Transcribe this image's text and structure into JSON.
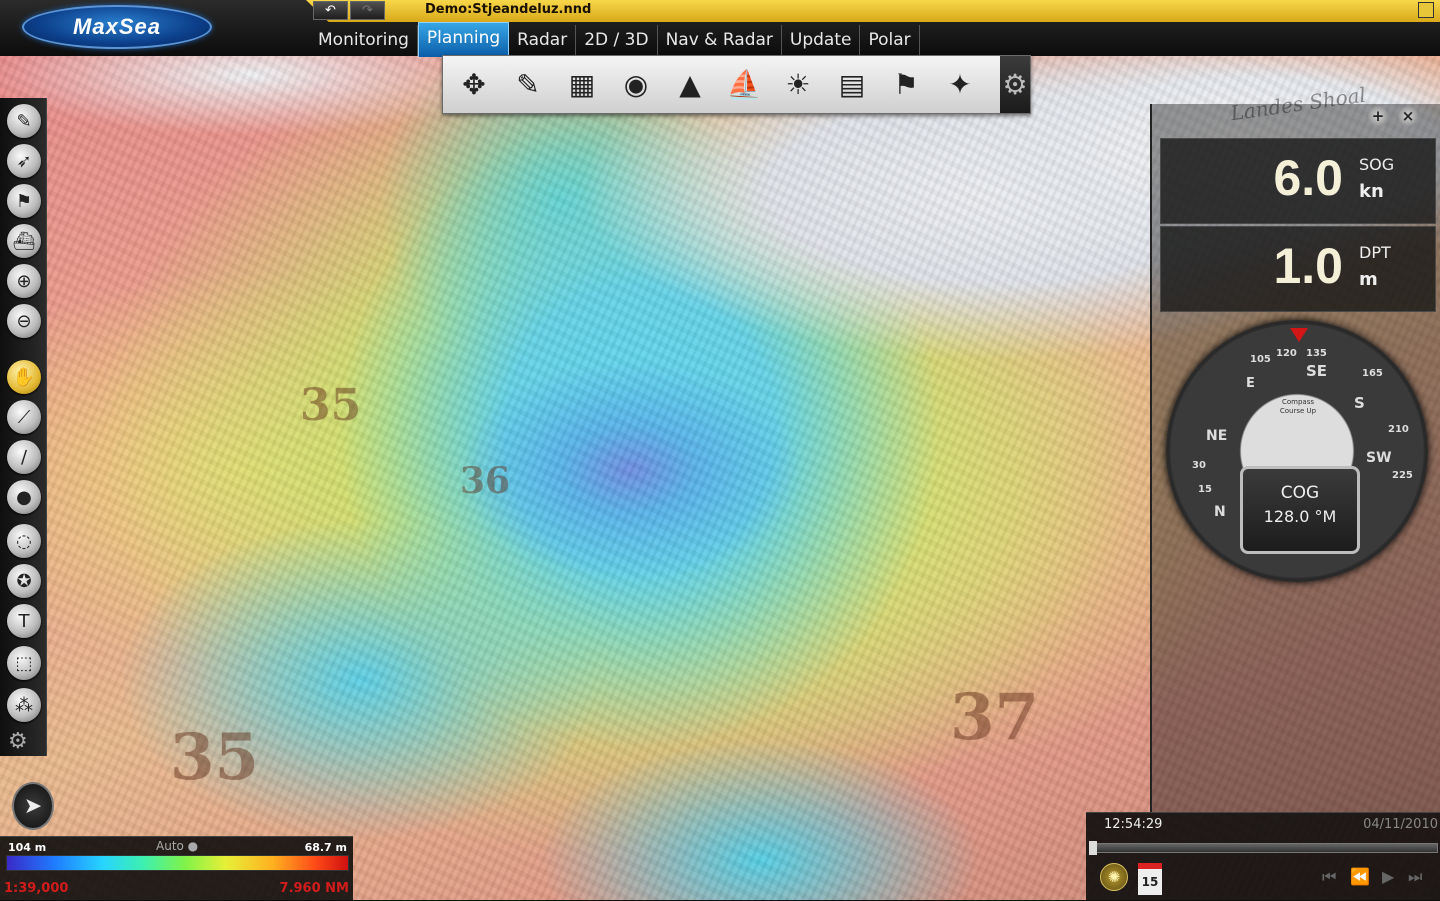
{
  "app": {
    "logo": "MaxSea",
    "document_title": "Demo:Stjeandeluz.nnd",
    "undo_icon": "undo-icon",
    "redo_icon": "redo-icon"
  },
  "tabs": [
    {
      "label": "Monitoring"
    },
    {
      "label": "Planning"
    },
    {
      "label": "Radar"
    },
    {
      "label": "2D / 3D"
    },
    {
      "label": "Nav & Radar"
    },
    {
      "label": "Update"
    },
    {
      "label": "Polar"
    }
  ],
  "active_tab": "Planning",
  "toolbar": {
    "tools": [
      {
        "icon": "compass-rose-icon",
        "glyph": "✥"
      },
      {
        "icon": "edit-route-icon",
        "glyph": "✎"
      },
      {
        "icon": "chart-layers-icon",
        "glyph": "▦"
      },
      {
        "icon": "sounder-icon",
        "glyph": "◉"
      },
      {
        "icon": "ais-target-icon",
        "glyph": "▲"
      },
      {
        "icon": "boat-icon",
        "glyph": "⛵"
      },
      {
        "icon": "weather-icon",
        "glyph": "☀"
      },
      {
        "icon": "tide-table-icon",
        "glyph": "▤"
      },
      {
        "icon": "flag-icon",
        "glyph": "⚑"
      },
      {
        "icon": "marks-icon",
        "glyph": "✦"
      }
    ],
    "settings_icon": "gear-icon"
  },
  "left_tools": [
    {
      "icon": "ruler-icon",
      "glyph": "✎"
    },
    {
      "icon": "cursor-icon",
      "glyph": "➶"
    },
    {
      "icon": "route-icon",
      "glyph": "⚑"
    },
    {
      "icon": "boat-tool-icon",
      "glyph": "⛴"
    },
    {
      "icon": "zoom-in-icon",
      "glyph": "⊕"
    },
    {
      "icon": "zoom-out-icon",
      "glyph": "⊖"
    },
    {
      "icon": "hand-pan-icon",
      "glyph": "✋"
    },
    {
      "icon": "measure-icon",
      "glyph": "⟋"
    },
    {
      "icon": "line-icon",
      "glyph": "∕"
    },
    {
      "icon": "circle-icon",
      "glyph": "●"
    },
    {
      "icon": "area-icon",
      "glyph": "◌"
    },
    {
      "icon": "mark-icon",
      "glyph": "✪"
    },
    {
      "icon": "text-icon",
      "glyph": "T"
    },
    {
      "icon": "select-area-icon",
      "glyph": "⬚"
    },
    {
      "icon": "objects-icon",
      "glyph": "⁂"
    }
  ],
  "map": {
    "depth_labels": [
      "35",
      "35",
      "37",
      "36"
    ],
    "place_name": "Landes Shoal"
  },
  "legend": {
    "min": "104 m",
    "max": "68.7 m",
    "mode": "Auto ●",
    "scale": "1:39,000",
    "distance": "7.960 NM",
    "colors": [
      "#3a2ac8",
      "#1f7cff",
      "#27d4ff",
      "#3ef0b0",
      "#7ff24a",
      "#e6f037",
      "#ffb020",
      "#ff4d18",
      "#d01010"
    ]
  },
  "instruments": {
    "sog": {
      "label": "SOG",
      "value": "6.0",
      "unit": "kn"
    },
    "dpt": {
      "label": "DPT",
      "value": "1.0",
      "unit": "m"
    },
    "compass": {
      "mode_line1": "Compass",
      "mode_line2": "Course Up",
      "labels": [
        "120",
        "135",
        "105",
        "E",
        "SE",
        "165",
        "S",
        "NE",
        "SW",
        "210",
        "225",
        "30",
        "15",
        "N"
      ],
      "cog_label": "COG",
      "cog_value": "128.0 °M"
    }
  },
  "timebar": {
    "time": "12:54:29",
    "date": "04/11/2010",
    "calendar_day": "15",
    "playback_icons": [
      "skip-start-icon",
      "previous-icon",
      "play-icon",
      "next-icon"
    ],
    "playback_glyphs": [
      "⏮",
      "⏪",
      "▶",
      "⏭"
    ]
  }
}
